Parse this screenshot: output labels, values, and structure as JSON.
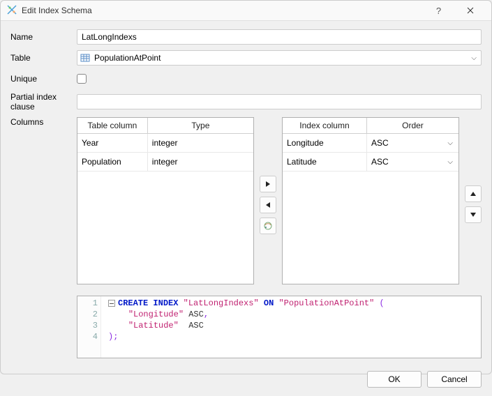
{
  "dialog": {
    "title": "Edit Index Schema"
  },
  "labels": {
    "name": "Name",
    "table": "Table",
    "unique": "Unique",
    "partial": "Partial index clause",
    "columns": "Columns"
  },
  "fields": {
    "name_value": "LatLongIndexs",
    "table_value": "PopulationAtPoint",
    "unique_checked": false,
    "partial_value": ""
  },
  "left_grid": {
    "headers": [
      "Table column",
      "Type"
    ],
    "rows": [
      {
        "col": "Year",
        "type": "integer"
      },
      {
        "col": "Population",
        "type": "integer"
      }
    ]
  },
  "right_grid": {
    "headers": [
      "Index column",
      "Order"
    ],
    "rows": [
      {
        "col": "Longitude",
        "order": "ASC"
      },
      {
        "col": "Latitude",
        "order": "ASC"
      }
    ]
  },
  "sql": {
    "line1_a": "CREATE",
    "line1_b": "INDEX",
    "line1_str1": "\"LatLongIndexs\"",
    "line1_c": "ON",
    "line1_str2": "\"PopulationAtPoint\"",
    "line1_sym": "(",
    "line2_str": "\"Longitude\"",
    "line2_txt": " ASC",
    "line2_sym": ",",
    "line3_str": "\"Latitude\"",
    "line3_txt": "  ASC",
    "line4_sym": ");",
    "n1": "1",
    "n2": "2",
    "n3": "3",
    "n4": "4"
  },
  "buttons": {
    "ok": "OK",
    "cancel": "Cancel"
  }
}
